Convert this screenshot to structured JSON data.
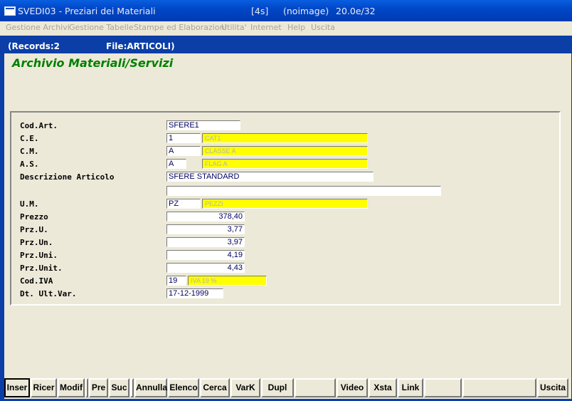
{
  "window": {
    "title": "SVEDI03 - Preziari dei Materiali",
    "time_tag": "[4s]",
    "image_tag": "(noimage)",
    "version": "20.0e/32"
  },
  "menu": [
    "Gestione Archivi",
    "Gestione Tabelle",
    "Stampe ed Elaborazioni",
    "Utilita'",
    "Internet",
    "Help",
    "Uscita"
  ],
  "status": {
    "records": "(Records:2",
    "file": "File:ARTICOLI)"
  },
  "page_title": "Archivio Materiali/Servizi",
  "form": {
    "cod_art": {
      "label": "Cod.Art.",
      "value": "SFERE1"
    },
    "ce": {
      "label": "C.E.",
      "value": "1",
      "desc": "CAT1"
    },
    "cm": {
      "label": "C.M.",
      "value": "A",
      "desc": "CLASSE A"
    },
    "as": {
      "label": "A.S.",
      "value": "A",
      "desc": "FLAG A"
    },
    "descrizione": {
      "label": "Descrizione Articolo",
      "value": "SFERE STANDARD",
      "value2": ""
    },
    "um": {
      "label": "U.M.",
      "value": "PZ",
      "desc": "PEZZI"
    },
    "prezzo": {
      "label": "Prezzo",
      "value": "378,40"
    },
    "prz_u": {
      "label": "Prz.U.",
      "value": "3,77"
    },
    "prz_un": {
      "label": "Prz.Un.",
      "value": "3,97"
    },
    "prz_uni": {
      "label": "Prz.Uni.",
      "value": "4,19"
    },
    "prz_unit": {
      "label": "Prz.Unit.",
      "value": "4,43"
    },
    "cod_iva": {
      "label": "Cod.IVA",
      "value": "19",
      "desc": "IVA 19 %"
    },
    "dt_ult_var": {
      "label": "Dt. Ult.Var.",
      "value": "17-12-1999"
    }
  },
  "buttons": {
    "inser": "Inser",
    "ricer": "Ricer",
    "modif": "Modif",
    "pre": "Pre",
    "suc": "Suc",
    "annulla": "Annulla",
    "elenco": "Elenco",
    "cerca": "Cerca",
    "vark": "VarK",
    "dupl": "Dupl",
    "video": "Video",
    "xsta": "Xsta",
    "link": "Link",
    "uscita": "Uscita"
  },
  "colors": {
    "title_green": "#008000",
    "lookup_yellow": "#ffff00",
    "titlebar_blue": "#0b3ea6"
  }
}
